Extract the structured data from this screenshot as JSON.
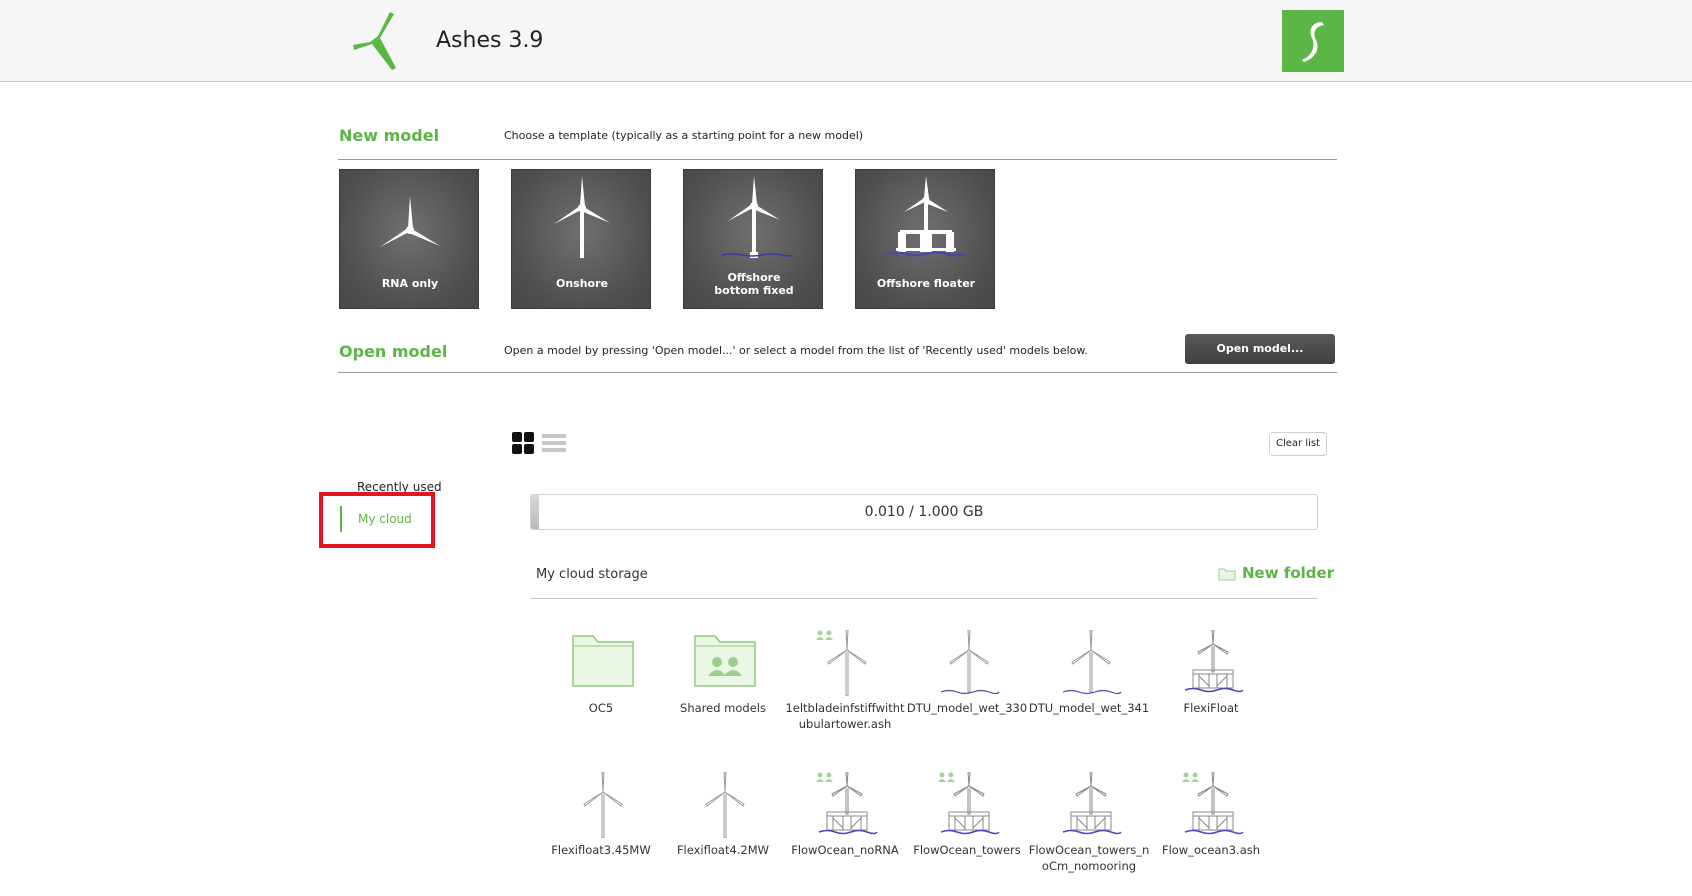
{
  "app": {
    "title": "Ashes 3.9"
  },
  "new_model": {
    "title": "New model",
    "description": "Choose a template (typically as a starting point for a new model)",
    "templates": [
      {
        "label": "RNA only"
      },
      {
        "label": "Onshore"
      },
      {
        "label": "Offshore",
        "label2": "bottom fixed"
      },
      {
        "label": "Offshore floater"
      }
    ]
  },
  "open_model": {
    "title": "Open model",
    "description": "Open a model by pressing 'Open model...' or select a model from the list of 'Recently used' models below.",
    "button_label": "Open model..."
  },
  "nav": {
    "recently_used": "Recently used",
    "my_cloud": "My cloud"
  },
  "toolbar": {
    "clear_list": "Clear list"
  },
  "storage": {
    "usage_text": "0.010 / 1.000 GB",
    "used_fraction": 0.01
  },
  "cloud": {
    "title": "My cloud storage",
    "new_folder": "New folder",
    "items": [
      {
        "label": "OC5",
        "type": "folder"
      },
      {
        "label": "Shared models",
        "type": "shared-folder"
      },
      {
        "label": "1eltbladeinfstiffwithtubulartower.ash",
        "type": "onshore",
        "shared": true
      },
      {
        "label": "DTU_model_wet_330",
        "type": "bottom-fixed",
        "shared": false
      },
      {
        "label": "DTU_model_wet_341",
        "type": "bottom-fixed",
        "shared": false
      },
      {
        "label": "FlexiFloat",
        "type": "floater",
        "shared": false
      },
      {
        "label": "Flexifloat3.45MW",
        "type": "onshore",
        "shared": false
      },
      {
        "label": "Flexifloat4.2MW",
        "type": "onshore",
        "shared": false
      },
      {
        "label": "FlowOcean_noRNA",
        "type": "floater",
        "shared": true
      },
      {
        "label": "FlowOcean_towers",
        "type": "floater",
        "shared": true
      },
      {
        "label": "FlowOcean_towers_noCm_nomooring",
        "type": "floater",
        "shared": false
      },
      {
        "label": "Flow_ocean3.ash",
        "type": "floater",
        "shared": true
      }
    ]
  },
  "colors": {
    "accent": "#5cb645",
    "highlight": "#e3161e",
    "tile_bg": "#555555"
  }
}
